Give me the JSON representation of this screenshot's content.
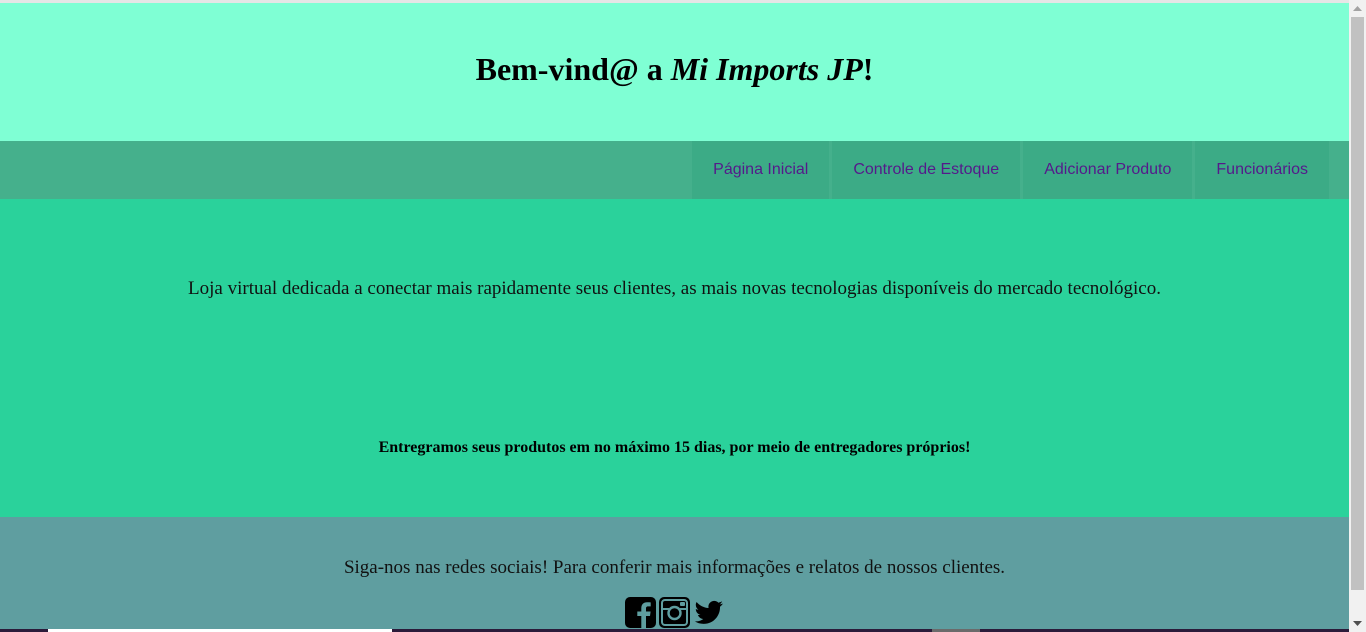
{
  "header": {
    "title_prefix": "Bem-vind@ a ",
    "title_brand": "Mi Imports JP",
    "title_suffix": "!"
  },
  "nav": {
    "items": [
      {
        "label": "Página Inicial"
      },
      {
        "label": "Controle de Estoque"
      },
      {
        "label": "Adicionar Produto"
      },
      {
        "label": "Funcionários"
      }
    ]
  },
  "main": {
    "intro": "Loja virtual dedicada a conectar mais rapidamente seus clientes, as mais novas tecnologias disponíveis do mercado tecnológico.",
    "delivery": "Entregramos seus produtos em no máximo 15 dias, por meio de entregadores próprios!"
  },
  "footer": {
    "follow_text": "Siga-nos nas redes sociais! Para conferir mais informações e relatos de nossos clientes.",
    "socials": [
      "facebook-icon",
      "instagram-icon",
      "twitter-icon"
    ]
  },
  "colors": {
    "header_bg": "#7fffd4",
    "nav_bg": "#45b08c",
    "main_bg": "#2ad29b",
    "footer_bg": "#5f9ea0",
    "link": "#551a8b"
  }
}
